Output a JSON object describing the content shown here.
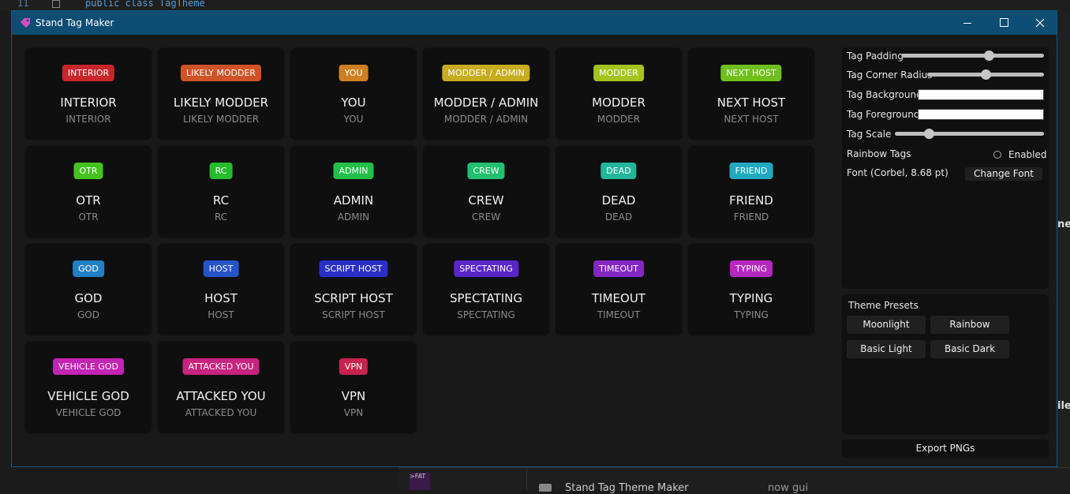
{
  "background": {
    "code_line_number": "11",
    "code_text": "public class TagTheme",
    "right_cut_text_1": "ne",
    "right_cut_text_2": "ile",
    "bottom_thumb_text": ">FAT",
    "bottom_item_name": "Stand Tag Theme Maker",
    "bottom_item_meta": "now gui"
  },
  "window": {
    "title": "Stand Tag Maker",
    "accent_color": "#0d4d73"
  },
  "tags": [
    {
      "label": "INTERIOR",
      "title": "INTERIOR",
      "sub": "INTERIOR",
      "color": "#c9252b"
    },
    {
      "label": "LIKELY MODDER",
      "title": "LIKELY MODDER",
      "sub": "LIKELY MODDER",
      "color": "#cf5326"
    },
    {
      "label": "YOU",
      "title": "YOU",
      "sub": "YOU",
      "color": "#cf7f22"
    },
    {
      "label": "MODDER / ADMIN",
      "title": "MODDER / ADMIN",
      "sub": "MODDER / ADMIN",
      "color": "#c7ac1f"
    },
    {
      "label": "MODDER",
      "title": "MODDER",
      "sub": "MODDER",
      "color": "#a6c21d"
    },
    {
      "label": "NEXT HOST",
      "title": "NEXT HOST",
      "sub": "NEXT HOST",
      "color": "#6fc01d"
    },
    {
      "label": "OTR",
      "title": "OTR",
      "sub": "OTR",
      "color": "#45c21e"
    },
    {
      "label": "RC",
      "title": "RC",
      "sub": "RC",
      "color": "#25bd2a"
    },
    {
      "label": "ADMIN",
      "title": "ADMIN",
      "sub": "ADMIN",
      "color": "#22c048"
    },
    {
      "label": "CREW",
      "title": "CREW",
      "sub": "CREW",
      "color": "#22c06f"
    },
    {
      "label": "DEAD",
      "title": "DEAD",
      "sub": "DEAD",
      "color": "#22b69a"
    },
    {
      "label": "FRIEND",
      "title": "FRIEND",
      "sub": "FRIEND",
      "color": "#21a9c0"
    },
    {
      "label": "GOD",
      "title": "GOD",
      "sub": "GOD",
      "color": "#2280c4"
    },
    {
      "label": "HOST",
      "title": "HOST",
      "sub": "HOST",
      "color": "#2454c7"
    },
    {
      "label": "SCRIPT HOST",
      "title": "SCRIPT HOST",
      "sub": "SCRIPT HOST",
      "color": "#2a2fc7"
    },
    {
      "label": "SPECTATING",
      "title": "SPECTATING",
      "sub": "SPECTATING",
      "color": "#5927c7"
    },
    {
      "label": "TIMEOUT",
      "title": "TIMEOUT",
      "sub": "TIMEOUT",
      "color": "#8427c3"
    },
    {
      "label": "TYPING",
      "title": "TYPING",
      "sub": "TYPING",
      "color": "#b527c1"
    },
    {
      "label": "VEHICLE GOD",
      "title": "VEHICLE GOD",
      "sub": "VEHICLE GOD",
      "color": "#c324b3"
    },
    {
      "label": "ATTACKED YOU",
      "title": "ATTACKED YOU",
      "sub": "ATTACKED YOU",
      "color": "#c8237f"
    },
    {
      "label": "VPN",
      "title": "VPN",
      "sub": "VPN",
      "color": "#c8234f"
    }
  ],
  "settings": {
    "padding_label": "Tag Padding",
    "padding_value": 0.61,
    "corner_label": "Tag Corner Radius",
    "corner_value": 0.5,
    "background_label": "Tag Background",
    "background_color": "#ffffff",
    "foreground_label": "Tag Foreground",
    "foreground_color": "#ffffff",
    "scale_label": "Tag Scale",
    "scale_value": 0.23,
    "rainbow_label": "Rainbow Tags",
    "enabled_label": "Enabled",
    "font_label": "Font (Corbel, 8.68 pt)",
    "change_font_label": "Change Font"
  },
  "presets": {
    "title": "Theme Presets",
    "items": [
      "Moonlight",
      "Rainbow",
      "Basic Light",
      "Basic Dark"
    ]
  },
  "export_label": "Export PNGs"
}
